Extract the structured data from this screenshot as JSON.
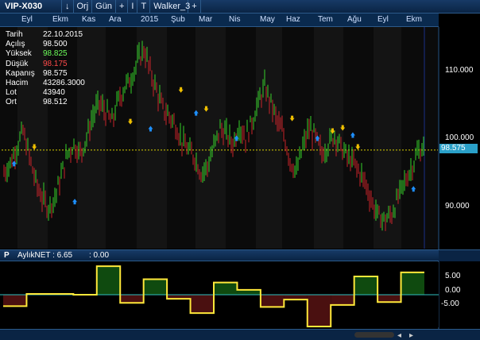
{
  "toolbar": {
    "symbol": "VIP-X030",
    "down_icon": "↓",
    "scale_label": "Orj",
    "period_label": "Gün",
    "add_label": "+",
    "info_label": "I",
    "text_tool_label": "T",
    "template_label": "Walker_3",
    "nav_label": "+"
  },
  "months": [
    "Eyl",
    "Ekm",
    "Kas",
    "Ara",
    "2015",
    "Şub",
    "Mar",
    "Nis",
    "May",
    "Haz",
    "Tem",
    "Ağu",
    "Eyl",
    "Ekm"
  ],
  "info": {
    "date_label": "Tarih",
    "date": "22.10.2015",
    "open_label": "Açılış",
    "open": "98.500",
    "high_label": "Yüksek",
    "high": "98.825",
    "low_label": "Düşük",
    "low": "98.175",
    "close_label": "Kapanış",
    "close": "98.575",
    "volume_label": "Hacim",
    "volume": "43286.3000",
    "lot_label": "Lot",
    "lot": "43940",
    "avg_label": "Ort",
    "avg": "98.512"
  },
  "price_axis": {
    "labels": [
      "110.000",
      "100.000",
      "90.000"
    ],
    "current": "98.575"
  },
  "panel": {
    "id": "P",
    "indicator": "AylıkNET : 6.65",
    "indicator2": ": 0.00",
    "axis_labels": [
      "5.00",
      "0.00",
      "-5.00"
    ]
  },
  "colors": {
    "up": "#36d02a",
    "down": "#c8232a",
    "signal_up": "#1e90ff",
    "signal_down": "#f0c000",
    "step_line": "#ffe83a",
    "zero_line": "#30c0c0",
    "hist_pos": "#0f4a0f",
    "hist_neg": "#4a1010"
  },
  "chart_data": {
    "type": "bar",
    "price": {
      "ylim": [
        83,
        118
      ],
      "current": 98.575,
      "trend": [
        95.0,
        96.5,
        99.0,
        101.5,
        97.5,
        93.5,
        91.0,
        89.5,
        91.0,
        94.5,
        98.0,
        99.5,
        98.0,
        100.5,
        104.0,
        106.0,
        104.5,
        103.0,
        106.5,
        108.5,
        110.0,
        112.5,
        114.5,
        111.0,
        108.0,
        105.0,
        104.0,
        102.5,
        100.0,
        98.5,
        97.5,
        95.0,
        96.0,
        99.0,
        102.0,
        101.0,
        99.5,
        102.5,
        100.5,
        103.0,
        106.0,
        108.5,
        106.0,
        103.0,
        101.0,
        97.0,
        95.0,
        99.0,
        102.0,
        100.5,
        98.0,
        99.5,
        101.0,
        99.0,
        97.5,
        96.5,
        95.0,
        93.0,
        90.0,
        88.0,
        87.5,
        88.5,
        91.0,
        93.5,
        95.5,
        98.0,
        99.0
      ]
    },
    "signals": {
      "up": [
        [
          2,
          96.5
        ],
        [
          14,
          90.5
        ],
        [
          29,
          102.0
        ],
        [
          38,
          104.5
        ],
        [
          46,
          100.5
        ],
        [
          62,
          100.5
        ],
        [
          69,
          101.0
        ],
        [
          81,
          92.5
        ]
      ],
      "down": [
        [
          6,
          99.0
        ],
        [
          25,
          103.0
        ],
        [
          35,
          108.0
        ],
        [
          40,
          105.0
        ],
        [
          57,
          103.5
        ],
        [
          65,
          101.5
        ],
        [
          67,
          102.0
        ],
        [
          70,
          99.0
        ]
      ]
    },
    "indicator": {
      "ylim": [
        -8,
        8
      ],
      "zero": 0,
      "steps": [
        -2.8,
        0.2,
        0.2,
        0.0,
        7.0,
        -2.0,
        3.8,
        -1.0,
        -4.5,
        3.0,
        1.2,
        -3.0,
        -1.2,
        -7.8,
        -2.5,
        4.5,
        -1.8,
        5.5
      ],
      "last": 6.65
    }
  }
}
